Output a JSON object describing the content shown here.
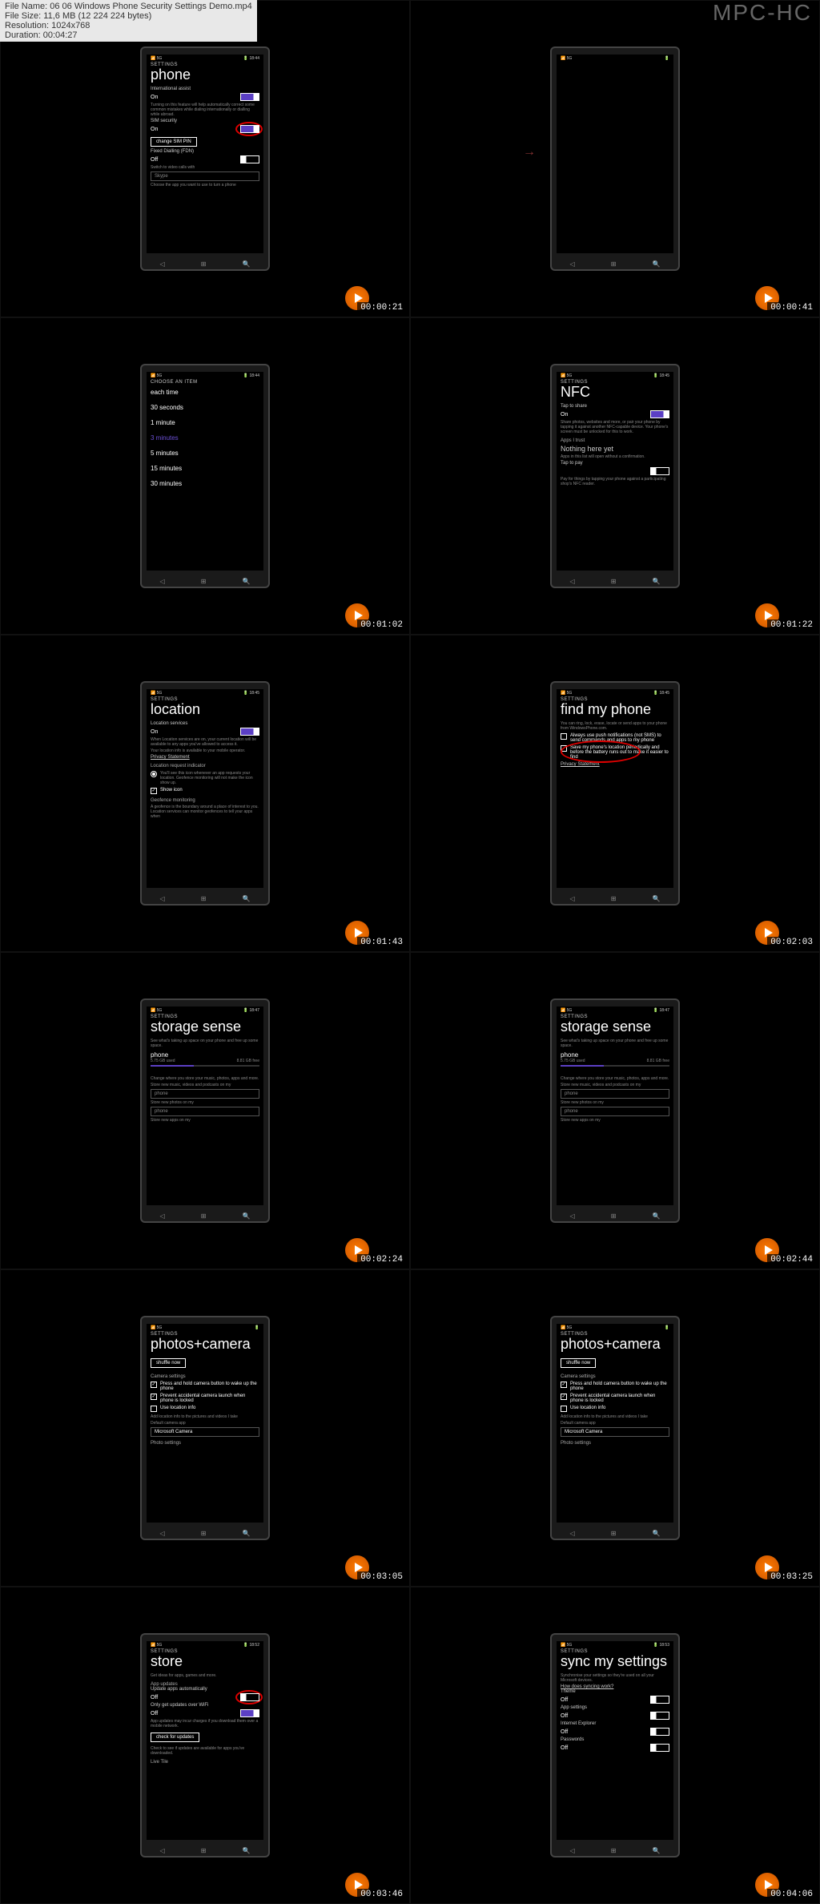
{
  "file_info": {
    "name_label": "File Name: ",
    "name": "06 06 Windows Phone Security Settings Demo.mp4",
    "size_label": "File Size: ",
    "size": "11,6 MB (12 224 224 bytes)",
    "res_label": "Resolution: ",
    "res": "1024x768",
    "dur_label": "Duration: ",
    "dur": "00:04:27"
  },
  "app_name": "MPC-HC",
  "settings_label": "SETTINGS",
  "thumbs": [
    {
      "ts": "00:00:21",
      "title": "phone",
      "time": "18:44",
      "rows": [
        {
          "label": "International assist",
          "value": "On",
          "toggle": "on"
        },
        {
          "desc": "Turning on this feature will help automatically correct some common mistakes while dialing internationally or dialling while abroad."
        },
        {
          "label": "SIM security",
          "value": "On",
          "toggle": "on",
          "circle": true
        },
        {
          "btn": "change SIM PIN"
        },
        {
          "label": "Fixed Dialling (FDN)",
          "value": "Off",
          "toggle": "off"
        },
        {
          "desc": "Switch to video calls with"
        },
        {
          "input": "Skype"
        },
        {
          "desc": "Choose the app you want to use to turn a phone"
        }
      ]
    },
    {
      "ts": "00:00:41",
      "title": "",
      "time": "",
      "empty": true,
      "arrow": true
    },
    {
      "ts": "00:01:02",
      "title": "",
      "time": "18:44",
      "header": "CHOOSE AN ITEM",
      "list": [
        "each time",
        "30 seconds",
        "1 minute",
        "3 minutes",
        "5 minutes",
        "15 minutes",
        "30 minutes"
      ],
      "selected": 3
    },
    {
      "ts": "00:01:22",
      "title": "NFC",
      "time": "18:45",
      "rows": [
        {
          "label": "Tap to share",
          "value": "On",
          "toggle": "on"
        },
        {
          "desc": "Share photos, websites and more, or pair your phone by tapping it against another NFC-capable device. Your phone's screen must be unlocked for this to work."
        },
        {
          "section": "Apps I trust"
        },
        {
          "subtitle": "Nothing here yet"
        },
        {
          "desc": "Apps in this list will open without a confirmation."
        },
        {
          "label": "Tap to pay",
          "value": "",
          "toggle": "off"
        },
        {
          "desc": "Pay for things by tapping your phone against a participating shop's NFC reader."
        }
      ]
    },
    {
      "ts": "00:01:43",
      "title": "location",
      "time": "18:45",
      "rows": [
        {
          "label": "Location services",
          "value": "On",
          "toggle": "on"
        },
        {
          "desc": "When Location services are on, your current location will be available to any apps you've allowed to access it."
        },
        {
          "desc": "Your location info is available to your mobile operator."
        },
        {
          "link": "Privacy Statement"
        },
        {
          "section": "Location request indicator"
        },
        {
          "radio": true,
          "desc": "You'll see this icon whenever an app requests your location. Geofence monitoring will not make the icon show up."
        },
        {
          "check": true,
          "text": "Show icon"
        },
        {
          "section": "Geofence monitoring"
        },
        {
          "desc": "A geofence is the boundary around a place of interest to you. Location services can monitor geofences to tell your apps when"
        }
      ]
    },
    {
      "ts": "00:02:03",
      "title": "find my phone",
      "time": "18:45",
      "rows": [
        {
          "desc": "You can ring, lock, erase, locate or send apps to your phone from WindowsPhone.com."
        },
        {
          "check": false,
          "text": "Always use push notifications (not SMS) to send commands and apps to my phone"
        },
        {
          "check": false,
          "text": "Save my phone's location periodically and before the battery runs out to make it easier to find",
          "circle": true
        },
        {
          "link": "Privacy Statement"
        }
      ]
    },
    {
      "ts": "00:02:24",
      "title": "storage sense",
      "time": "18:47",
      "storage": true
    },
    {
      "ts": "00:02:44",
      "title": "storage sense",
      "time": "18:47",
      "storage": true
    },
    {
      "ts": "00:03:05",
      "title": "photos+camera",
      "time": "",
      "camera": true
    },
    {
      "ts": "00:03:25",
      "title": "photos+camera",
      "time": "",
      "camera": true
    },
    {
      "ts": "00:03:46",
      "title": "store",
      "time": "18:52",
      "rows": [
        {
          "desc": "Get ideas for apps, games and more."
        },
        {
          "section": "App updates"
        },
        {
          "label": "Update apps automatically",
          "value": "Off",
          "toggle": "off",
          "circle": true
        },
        {
          "label": "Only get updates over WiFi",
          "value": "Off",
          "toggle": "on"
        },
        {
          "desc": "App updates may incur charges if you download them over a mobile network."
        },
        {
          "btn": "check for updates"
        },
        {
          "desc": "Check to see if updates are available for apps you've downloaded."
        },
        {
          "section": "Live Tile"
        }
      ]
    },
    {
      "ts": "00:04:06",
      "title": "sync my settings",
      "time": "18:53",
      "rows": [
        {
          "desc": "Synchronise your settings so they're used on all your Microsoft devices."
        },
        {
          "link": "How does syncing work?"
        },
        {
          "label": "Theme",
          "value": "Off",
          "toggle": "off"
        },
        {
          "label": "App settings",
          "value": "Off",
          "toggle": "off"
        },
        {
          "label": "Internet Explorer",
          "value": "Off",
          "toggle": "off"
        },
        {
          "label": "Passwords",
          "value": "Off",
          "toggle": "off"
        }
      ]
    }
  ],
  "storage_content": {
    "desc": "See what's taking up space on your phone and free up some space.",
    "phone_label": "phone",
    "used": "5.75 GB used",
    "free": "8.81 GB free",
    "change_desc": "Change where you store your music, photos, apps and more.",
    "new_music": "Store new music, videos and podcasts on my",
    "new_photos": "Store new photos on my",
    "new_apps": "Store new apps on my",
    "phone_opt": "phone"
  },
  "camera_content": {
    "shuffle": "shuffle now",
    "section": "Camera settings",
    "opt1": "Press and hold camera button to wake up the phone",
    "opt2": "Prevent accidental camera launch when phone is locked",
    "opt3": "Use location info",
    "loc_desc": "Add location info to the pictures and videos I take",
    "default_label": "Default camera app",
    "default_app": "Microsoft Camera",
    "photo_section": "Photo settings"
  }
}
